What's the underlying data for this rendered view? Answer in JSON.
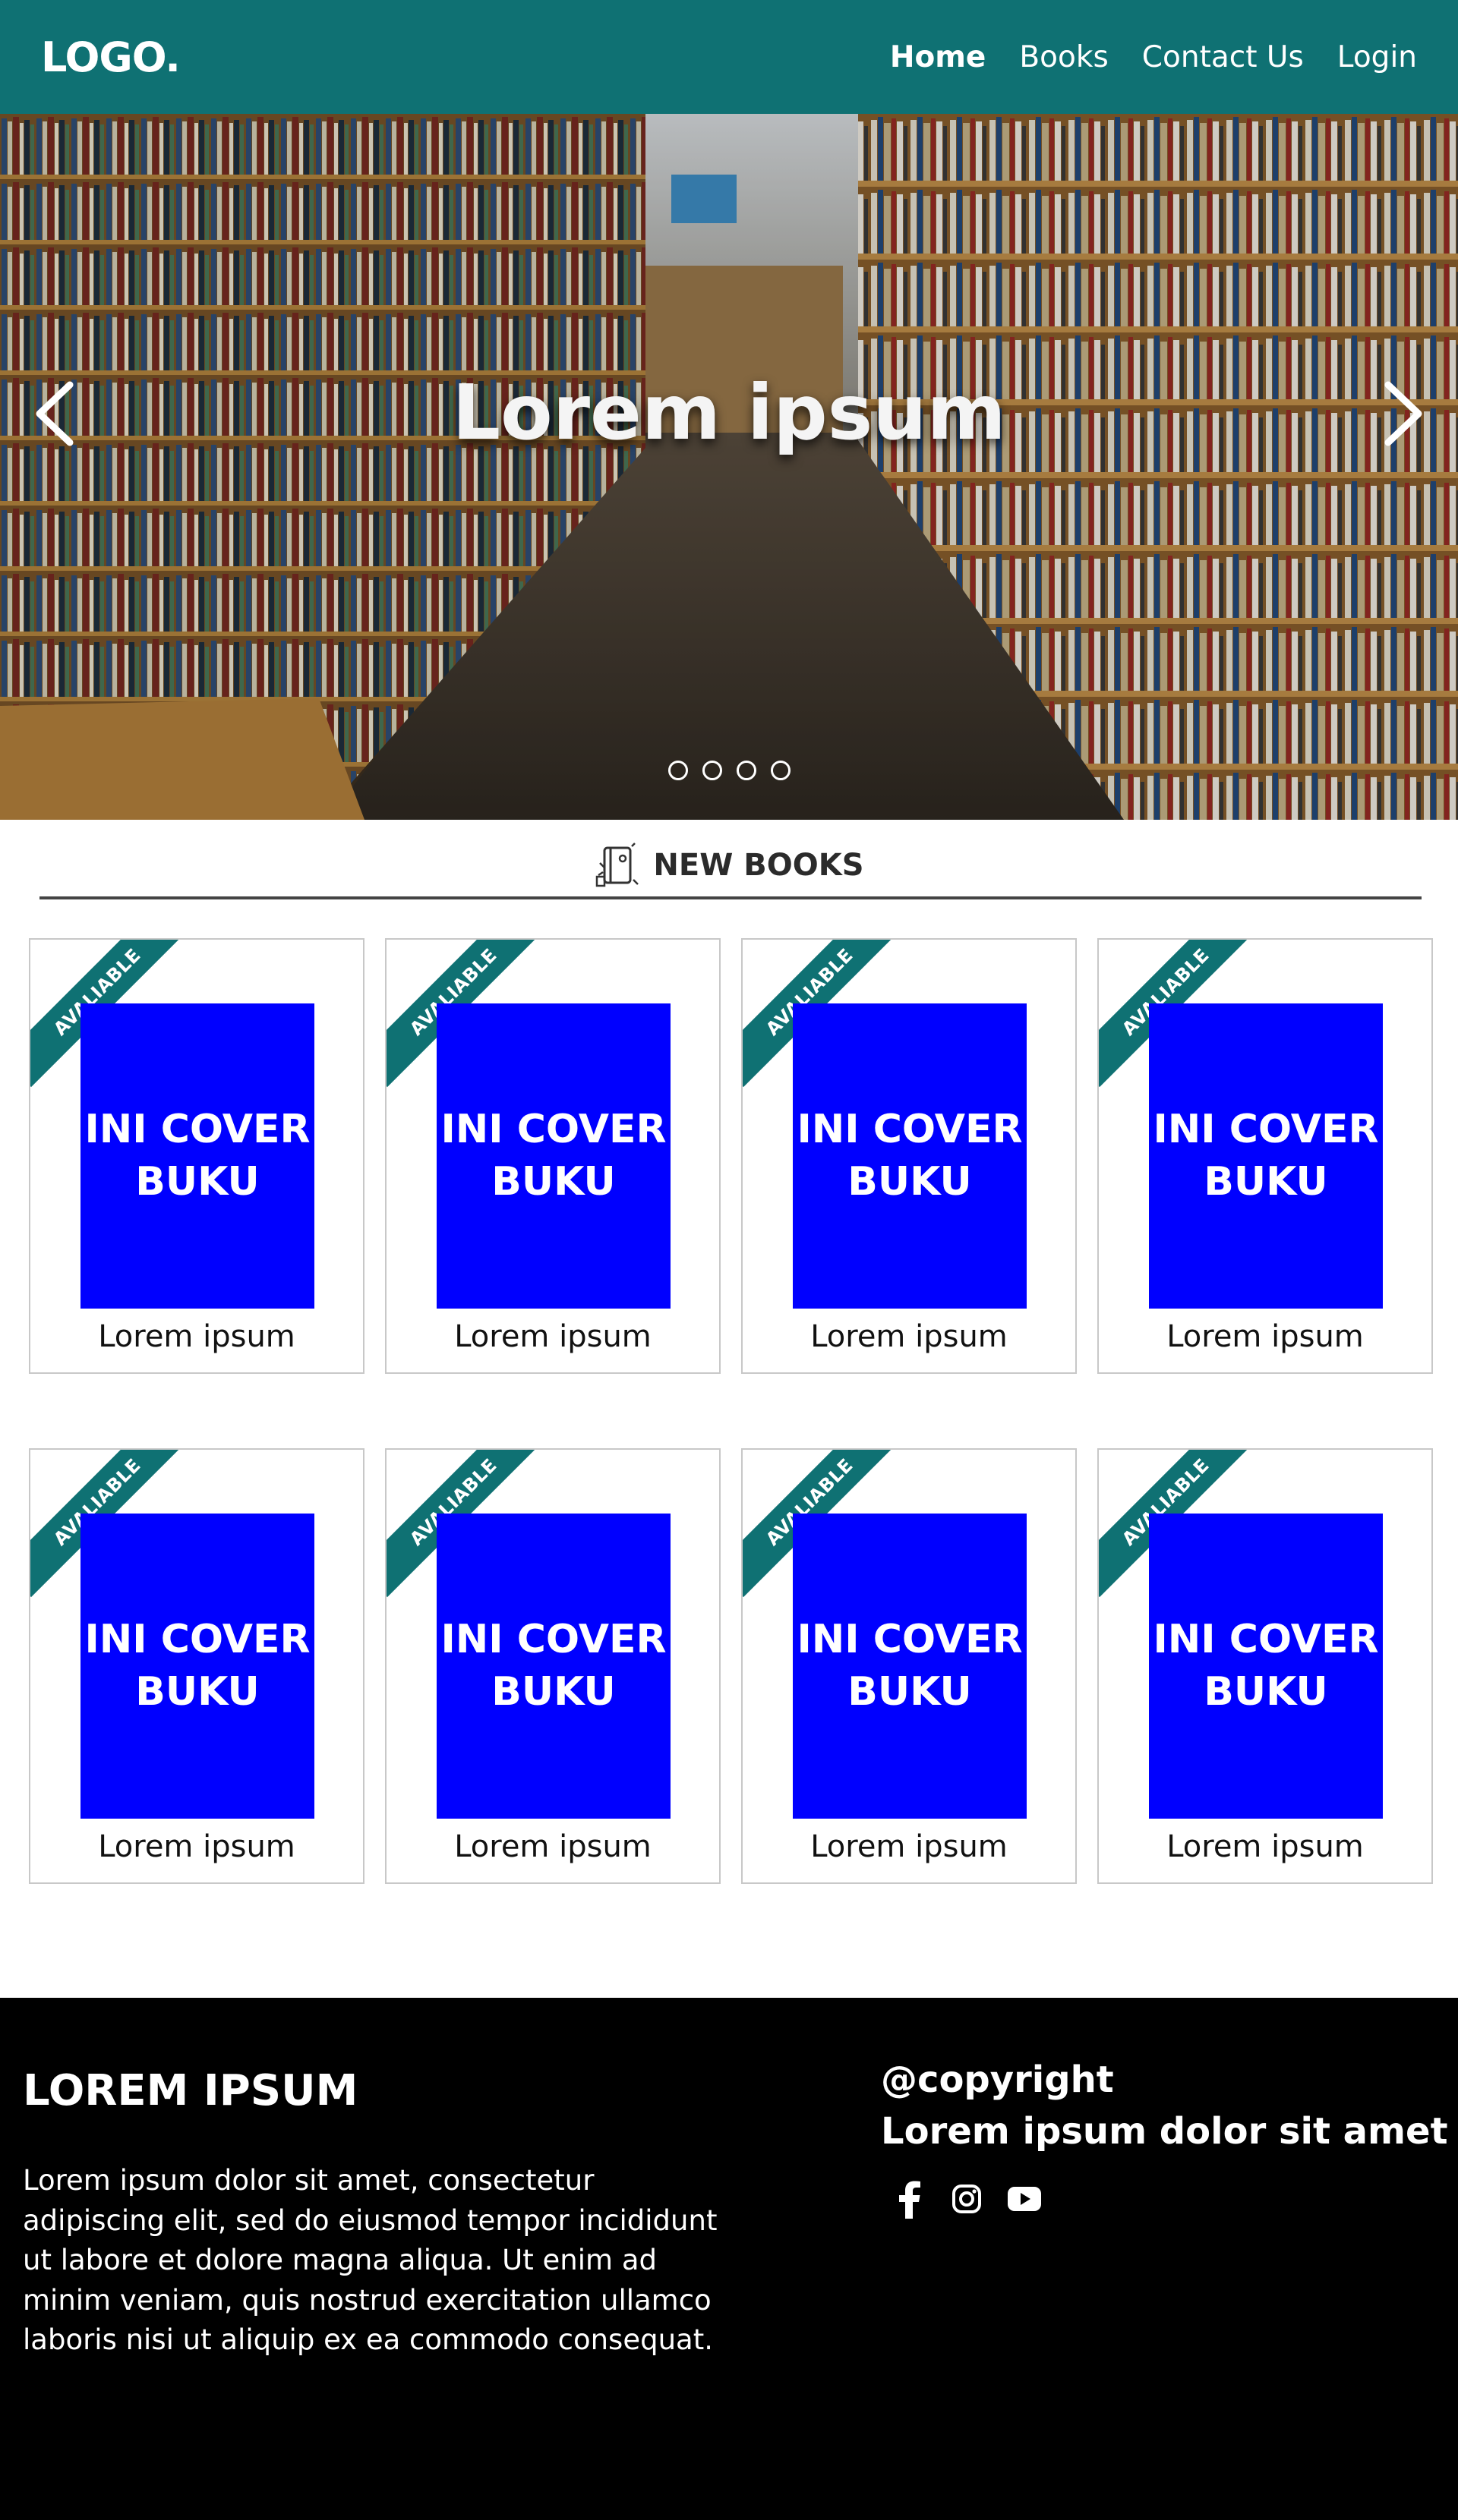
{
  "nav": {
    "logo": "LOGO.",
    "links": [
      "Home",
      "Books",
      "Contact Us",
      "Login"
    ],
    "active": "Home",
    "color": "#0f7173"
  },
  "hero": {
    "title": "Lorem ipsum",
    "slides_count": 4
  },
  "section": {
    "title": "NEW BOOKS",
    "icon": "book-shelf-icon"
  },
  "books": [
    {
      "ribbon": "AVALIABLE",
      "cover": "INI COVER BUKU",
      "title": "Lorem ipsum"
    },
    {
      "ribbon": "AVALIABLE",
      "cover": "INI COVER BUKU",
      "title": "Lorem ipsum"
    },
    {
      "ribbon": "AVALIABLE",
      "cover": "INI COVER BUKU",
      "title": "Lorem ipsum"
    },
    {
      "ribbon": "AVALIABLE",
      "cover": "INI COVER BUKU",
      "title": "Lorem ipsum"
    },
    {
      "ribbon": "AVALIABLE",
      "cover": "INI COVER BUKU",
      "title": "Lorem ipsum"
    },
    {
      "ribbon": "AVALIABLE",
      "cover": "INI COVER BUKU",
      "title": "Lorem ipsum"
    },
    {
      "ribbon": "AVALIABLE",
      "cover": "INI COVER BUKU",
      "title": "Lorem ipsum"
    },
    {
      "ribbon": "AVALIABLE",
      "cover": "INI COVER BUKU",
      "title": "Lorem ipsum"
    }
  ],
  "colors": {
    "accent": "#0f7173",
    "cover": "#0000ff",
    "footer_bg": "#000000"
  },
  "footer": {
    "title": "LOREM IPSUM",
    "text": "Lorem ipsum dolor sit amet, consectetur adipiscing elit, sed do eiusmod tempor incididunt ut labore et dolore magna aliqua. Ut enim ad minim veniam, quis nostrud exercitation ullamco laboris nisi ut aliquip ex ea commodo consequat.",
    "copyright": "@copyright",
    "copyright_sub": "Lorem ipsum dolor sit amet",
    "socials": [
      "facebook-icon",
      "instagram-icon",
      "youtube-icon"
    ]
  }
}
